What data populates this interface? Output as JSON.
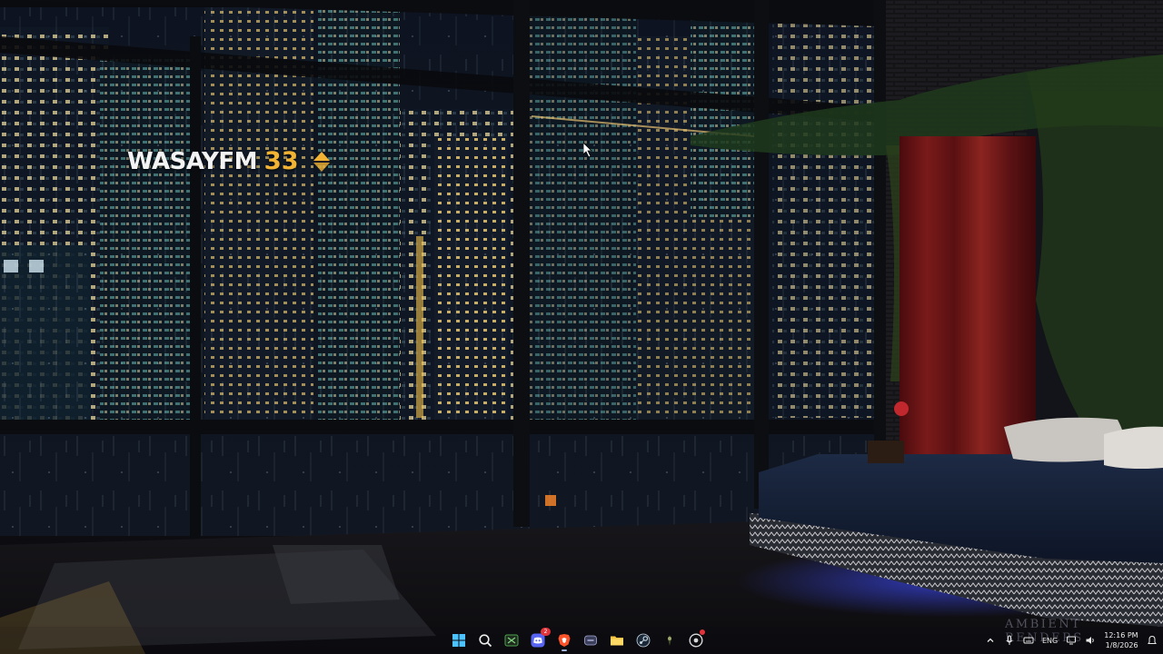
{
  "desktop": {
    "wallpaper": "night-city-bedroom-rain",
    "overlay": {
      "channel_name": "WASAYFM",
      "channel_number": "33"
    },
    "watermark": "AMBIENT RENDERS"
  },
  "taskbar": {
    "apps": [
      {
        "name": "Start",
        "icon": "windows-start-icon"
      },
      {
        "name": "Search",
        "icon": "search-icon"
      },
      {
        "name": "Xbox",
        "icon": "xbox-icon"
      },
      {
        "name": "Discord",
        "icon": "discord-icon",
        "badge": "2"
      },
      {
        "name": "Brave",
        "icon": "brave-icon",
        "active": true
      },
      {
        "name": "Window",
        "icon": "app-window-icon"
      },
      {
        "name": "File Explorer",
        "icon": "folder-icon"
      },
      {
        "name": "Steam",
        "icon": "steam-icon"
      },
      {
        "name": "Game",
        "icon": "game-icon"
      },
      {
        "name": "Chrome",
        "icon": "chrome-icon",
        "notification": true
      }
    ],
    "tray": {
      "language": "ENG",
      "time": "12:16 PM",
      "date": "1/8/2026"
    }
  },
  "colors": {
    "accent": "#f2b233",
    "discord": "#5865f2",
    "brave": "#fb542b",
    "xbox": "#107c10",
    "folder": "#f6c447",
    "windows": "#4cc2ff"
  }
}
